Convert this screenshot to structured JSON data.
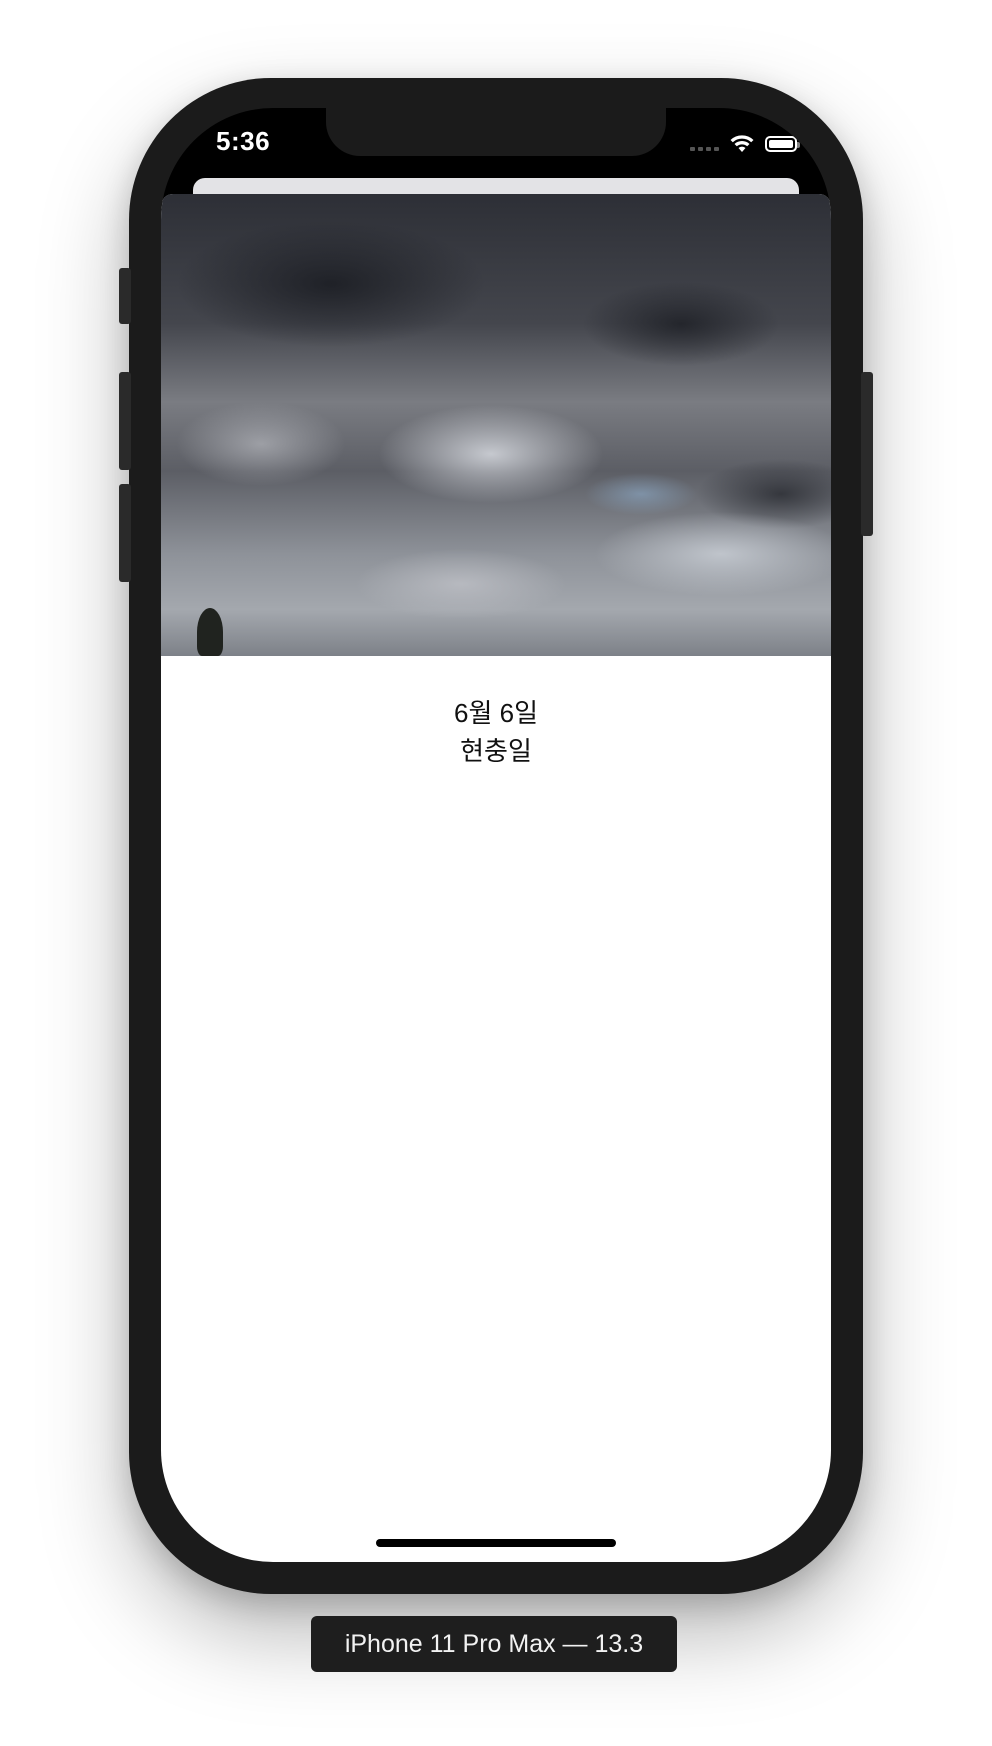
{
  "status_bar": {
    "time": "5:36",
    "icons": [
      "cellular-icon",
      "wifi-icon",
      "battery-icon"
    ]
  },
  "content": {
    "image": "cloudy-sky-photo",
    "date": "6월 6일",
    "holiday": "현충일"
  },
  "simulator": {
    "device_label": "iPhone 11 Pro Max — 13.3"
  },
  "colors": {
    "frame": "#1b1b1b",
    "screen_background": "#ffffff",
    "status_text": "#ffffff",
    "label_background": "#1e1e1e"
  }
}
